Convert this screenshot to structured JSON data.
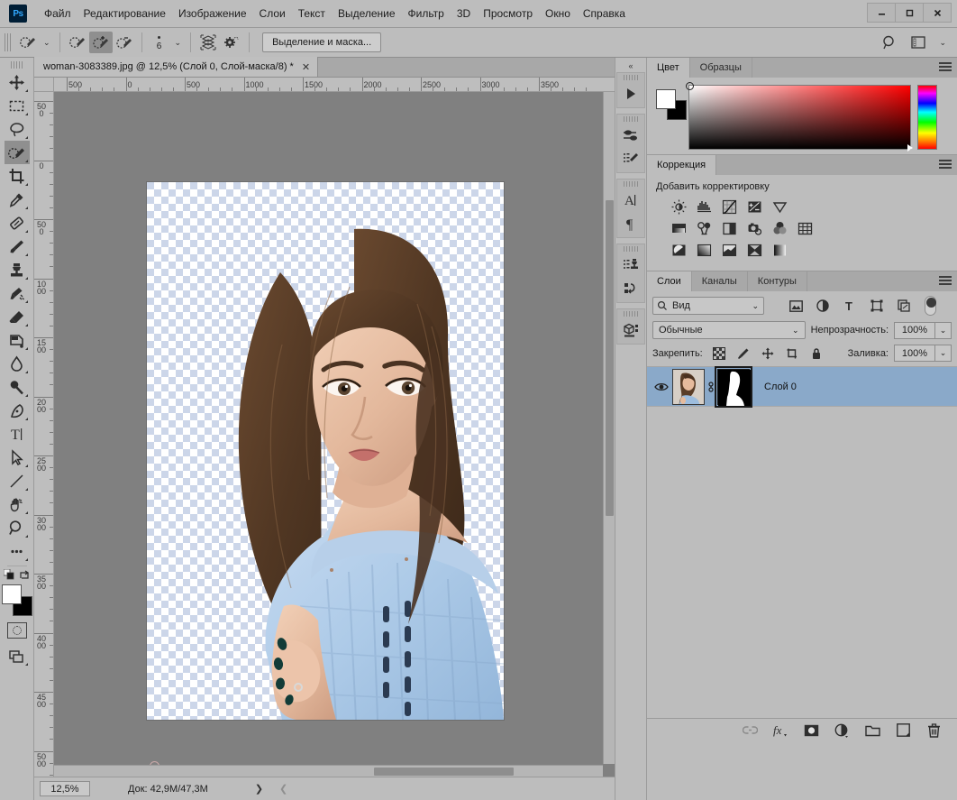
{
  "app": {
    "logo": "Ps",
    "menus": [
      "Файл",
      "Редактирование",
      "Изображение",
      "Слои",
      "Текст",
      "Выделение",
      "Фильтр",
      "3D",
      "Просмотр",
      "Окно",
      "Справка"
    ],
    "window_controls": {
      "minimize": "–",
      "maximize": "□",
      "close": "✕"
    }
  },
  "options_bar": {
    "tool_preset": "quick-selection-tool-preset",
    "modes": [
      "new-selection",
      "add-to-selection",
      "subtract-from-selection"
    ],
    "active_mode_index": 1,
    "brush_size": "6",
    "sample_all_layers": "sample-all-layers-icon",
    "settings": "brush-settings-icon",
    "select_and_mask_label": "Выделение и маска...",
    "search_icon": "search-icon",
    "workspace_icon": "workspace-switcher-icon"
  },
  "toolbar": {
    "tools": [
      {
        "name": "move-tool",
        "active": false
      },
      {
        "name": "rectangular-marquee-tool",
        "active": false
      },
      {
        "name": "lasso-tool",
        "active": false
      },
      {
        "name": "quick-selection-tool",
        "active": true
      },
      {
        "name": "crop-tool",
        "active": false
      },
      {
        "name": "eyedropper-tool",
        "active": false
      },
      {
        "name": "spot-healing-brush-tool",
        "active": false
      },
      {
        "name": "brush-tool",
        "active": false
      },
      {
        "name": "clone-stamp-tool",
        "active": false
      },
      {
        "name": "history-brush-tool",
        "active": false
      },
      {
        "name": "eraser-tool",
        "active": false
      },
      {
        "name": "gradient-tool",
        "active": false
      },
      {
        "name": "blur-tool",
        "active": false
      },
      {
        "name": "dodge-tool",
        "active": false
      },
      {
        "name": "pen-tool",
        "active": false
      },
      {
        "name": "type-tool",
        "active": false
      },
      {
        "name": "path-selection-tool",
        "active": false
      },
      {
        "name": "line-tool",
        "active": false
      },
      {
        "name": "hand-tool",
        "active": false
      },
      {
        "name": "zoom-tool",
        "active": false
      },
      {
        "name": "edit-toolbar-tool",
        "active": false
      }
    ],
    "foreground_color": "#ffffff",
    "background_color": "#000000",
    "quick_mask": "quick-mask-mode-icon",
    "screen_mode": "screen-mode-icon"
  },
  "document": {
    "tab_title": "woman-3083389.jpg @ 12,5% (Слой 0, Слой-маска/8) *",
    "close_label": "✕",
    "ruler_h_labels": [
      "500",
      "0",
      "500",
      "1000",
      "1500",
      "2000",
      "2500",
      "3000",
      "3500"
    ],
    "ruler_v_labels": [
      "500",
      "0",
      "500",
      "1000",
      "1500",
      "2000",
      "2500",
      "3000",
      "3500",
      "4000",
      "4500",
      "5000"
    ],
    "canvas_background": "#808080",
    "transparency_checker_colors": [
      "#ffffff",
      "#ccd6e9"
    ]
  },
  "status_bar": {
    "zoom": "12,5%",
    "doc_info": "Док: 42,9M/47,3M",
    "expand_arrow": "❯",
    "collapse_arrow": "❮"
  },
  "dock_rail": {
    "collapse_icon": "collapse-panels-icon",
    "groups": [
      {
        "icons": [
          "timeline-play-icon"
        ]
      },
      {
        "icons": [
          "properties-icon",
          "brush-settings-icon"
        ]
      },
      {
        "icons": [
          "character-panel-icon",
          "paragraph-panel-icon"
        ]
      },
      {
        "icons": [
          "clone-source-icon",
          "history-icon"
        ]
      },
      {
        "icons": [
          "3d-panel-icon"
        ]
      }
    ]
  },
  "color_panel": {
    "tabs": [
      {
        "label": "Цвет",
        "active": true
      },
      {
        "label": "Образцы",
        "active": false
      }
    ],
    "menu_icon": "panel-menu-icon",
    "foreground": "#ffffff",
    "background": "#000000",
    "spectrum_base_hue": "#ff0000"
  },
  "adjustments_panel": {
    "tabs": [
      {
        "label": "Коррекция",
        "active": true
      }
    ],
    "menu_icon": "panel-menu-icon",
    "title": "Добавить корректировку",
    "rows": [
      [
        "brightness-contrast-icon",
        "levels-icon",
        "curves-icon",
        "exposure-icon",
        "vibrance-icon"
      ],
      [
        "gradient-map-icon",
        "color-balance-icon",
        "black-white-icon",
        "photo-filter-icon",
        "channel-mixer-icon",
        "color-lookup-icon"
      ],
      [
        "invert-icon",
        "posterize-icon",
        "threshold-icon",
        "selective-color-icon",
        "gradient-fill-icon"
      ]
    ]
  },
  "layers_panel": {
    "tabs": [
      {
        "label": "Слои",
        "active": true
      },
      {
        "label": "Каналы",
        "active": false
      },
      {
        "label": "Контуры",
        "active": false
      }
    ],
    "menu_icon": "panel-menu-icon",
    "filter": {
      "value": "Вид",
      "icon": "search-icon",
      "chevron": "⌄"
    },
    "filter_icons": [
      "pixel-filter-icon",
      "adjustment-filter-icon",
      "type-filter-icon",
      "shape-filter-icon",
      "smart-object-filter-icon"
    ],
    "filter_toggle": "filter-enable-toggle",
    "blend_mode": {
      "value": "Обычные",
      "chevron": "⌄"
    },
    "opacity": {
      "label": "Непрозрачность:",
      "value": "100%",
      "chevron": "⌄"
    },
    "lock": {
      "label": "Закрепить:",
      "icons": [
        "lock-transparent-pixels-icon",
        "lock-image-pixels-icon",
        "lock-position-icon",
        "lock-artboard-icon",
        "lock-all-icon"
      ]
    },
    "fill": {
      "label": "Заливка:",
      "value": "100%",
      "chevron": "⌄"
    },
    "layers": [
      {
        "name": "Слой 0",
        "visible": true,
        "selected": true,
        "linked": true,
        "has_mask": true,
        "thumbnail": "portrait-thumbnail",
        "mask_thumbnail": "layer-mask-thumbnail"
      }
    ],
    "footer_buttons": [
      "link-layers-icon",
      "layer-style-fx-icon",
      "add-layer-mask-icon",
      "new-adjustment-layer-icon",
      "new-group-icon",
      "new-layer-icon",
      "delete-layer-icon"
    ]
  }
}
